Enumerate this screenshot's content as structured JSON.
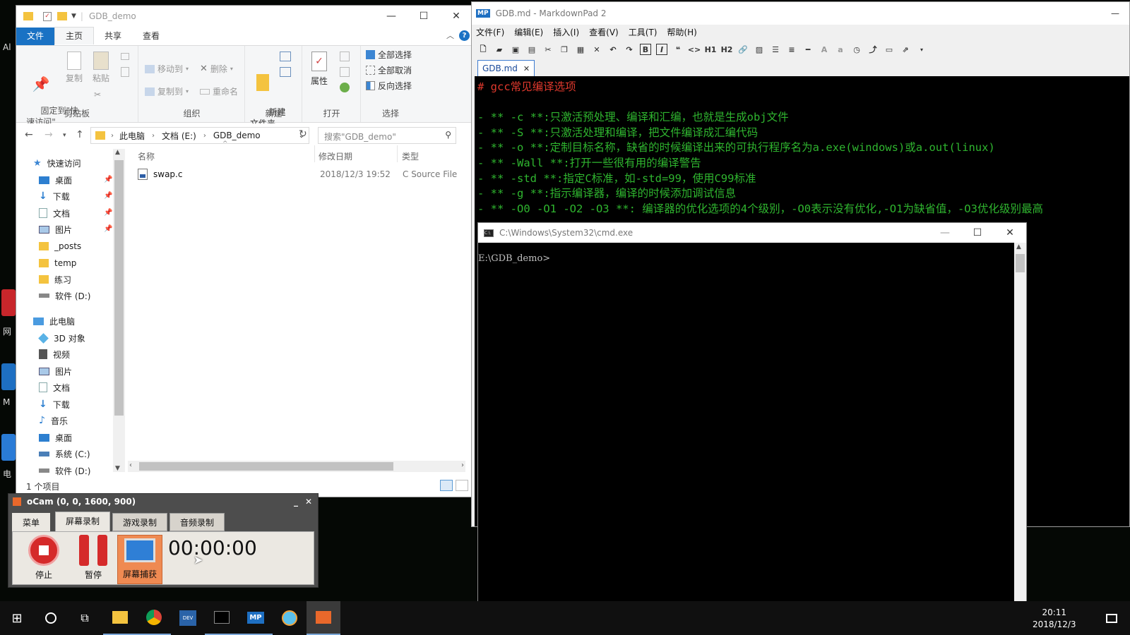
{
  "desktop": {
    "labels": [
      "Al",
      "网",
      "M",
      "电"
    ]
  },
  "explorer": {
    "title": "GDB_demo",
    "tabs": {
      "file": "文件",
      "home": "主页",
      "share": "共享",
      "view": "查看"
    },
    "ribbon": {
      "pin_quick_access": "固定到\"快\n速访问\"",
      "copy": "复制",
      "paste": "粘贴",
      "move_to": "移动到",
      "copy_to": "复制到",
      "delete": "删除",
      "rename": "重命名",
      "new_folder": "新建\n文件夹",
      "properties": "属性",
      "select_all": "全部选择",
      "select_none": "全部取消",
      "invert_selection": "反向选择",
      "groups": {
        "clipboard": "剪贴板",
        "organize": "组织",
        "new": "新建",
        "open": "打开",
        "select": "选择"
      }
    },
    "address": {
      "this_pc": "此电脑",
      "drive": "文档 (E:)",
      "folder": "GDB_demo"
    },
    "search_placeholder": "搜索\"GDB_demo\"",
    "nav": {
      "quick_access": "快速访问",
      "qa_items": [
        "桌面",
        "下载",
        "文档",
        "图片",
        "_posts",
        "temp",
        "练习",
        "软件 (D:)"
      ],
      "this_pc": "此电脑",
      "pc_items": [
        "3D 对象",
        "视频",
        "图片",
        "文档",
        "下载",
        "音乐",
        "桌面",
        "系统 (C:)",
        "软件 (D:)"
      ]
    },
    "columns": {
      "name": "名称",
      "date": "修改日期",
      "type": "类型"
    },
    "files": [
      {
        "name": "swap.c",
        "date": "2018/12/3 19:52",
        "type": "C Source File"
      }
    ],
    "status": "1 个项目"
  },
  "markdownpad": {
    "title": "GDB.md - MarkdownPad 2",
    "menu": [
      "文件(F)",
      "编辑(E)",
      "插入(I)",
      "查看(V)",
      "工具(T)",
      "帮助(H)"
    ],
    "tab": "GDB.md",
    "heading": "# gcc常见编译选项",
    "lines": [
      "- ** -c **:只激活预处理、编译和汇编，也就是生成obj文件",
      "- ** -S **:只激活处理和编译，把文件编译成汇编代码",
      "- ** -o **:定制目标名称，缺省的时候编译出来的可执行程序名为a.exe(windows)或a.out(linux)",
      "- ** -Wall **:打开一些很有用的编译警告",
      "- ** -std **:指定C标准，如-std=99，使用C99标准",
      "- ** -g **:指示编译器，编译的时候添加调试信息",
      "- ** -O0 -O1 -O2 -O3 **: 编译器的优化选项的4个级别，-O0表示没有优化,-O1为缺省值，-O3优化级别最高"
    ]
  },
  "cmd": {
    "title": "C:\\Windows\\System32\\cmd.exe",
    "prompt": "E:\\GDB_demo>"
  },
  "ocam": {
    "title": "oCam (0, 0, 1600, 900)",
    "tabs": [
      "菜单",
      "屏幕录制",
      "游戏录制",
      "音频录制"
    ],
    "stop": "停止",
    "pause": "暂停",
    "capture": "屏幕捕获",
    "timer": "00:00:00"
  },
  "taskbar": {
    "time": "20:11",
    "date": "2018/12/3"
  }
}
